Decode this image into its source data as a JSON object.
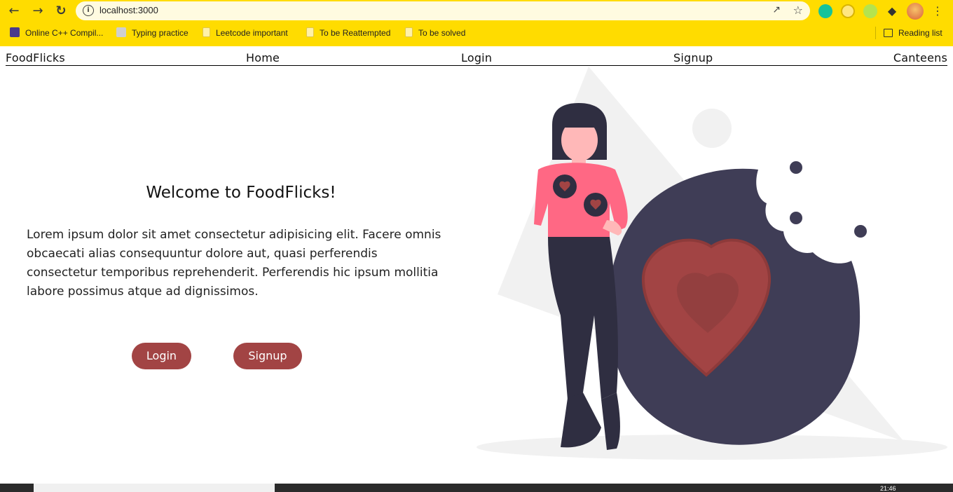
{
  "browser": {
    "url": "localhost:3000",
    "bookmarks": [
      {
        "label": "Online C++ Compil..."
      },
      {
        "label": "Typing practice"
      },
      {
        "label": "Leetcode important"
      },
      {
        "label": "To be Reattempted"
      },
      {
        "label": "To be solved"
      }
    ],
    "reading_list": "Reading list"
  },
  "nav": {
    "brand": "FoodFlicks",
    "home": "Home",
    "login": "Login",
    "signup": "Signup",
    "canteens": "Canteens"
  },
  "hero": {
    "title": "Welcome to FoodFlicks!",
    "body": "Lorem ipsum dolor sit amet consectetur adipisicing elit. Facere omnis obcaecati alias consequuntur dolore aut, quasi perferendis consectetur temporibus reprehenderit. Perferendis hic ipsum mollitia labore possimus atque ad dignissimos.",
    "login_button": "Login",
    "signup_button": "Signup"
  },
  "taskbar": {
    "clock": "21:46"
  },
  "colors": {
    "chrome": "#FFDC00",
    "accent": "#A24444",
    "cookie": "#3F3D56",
    "shirt": "#FF6884"
  }
}
